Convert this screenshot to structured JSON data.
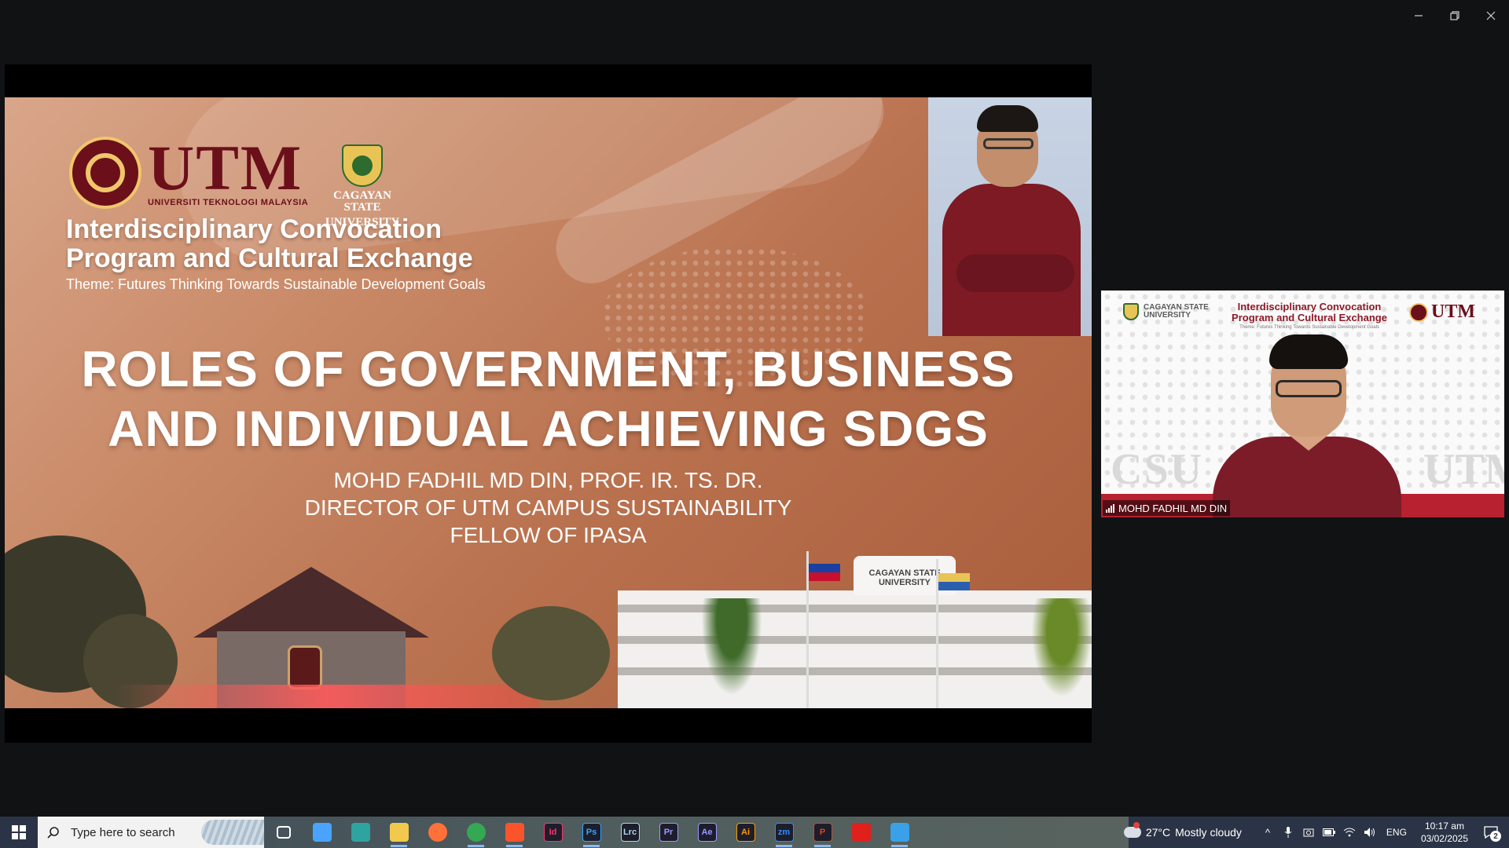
{
  "window": {
    "minimize_icon": "minimize-icon",
    "restore_icon": "restore-icon",
    "close_icon": "close-icon"
  },
  "slide": {
    "utm_logo_text": "UTM",
    "utm_logo_subtext": "UNIVERSITI TEKNOLOGI MALAYSIA",
    "csu_logo_line1": "CAGAYAN STATE",
    "csu_logo_line2": "UNIVERSITY",
    "program_line1": "Interdisciplinary Convocation",
    "program_line2": "Program and Cultural Exchange",
    "theme": "Theme: Futures Thinking Towards Sustainable Development Goals",
    "title_line1": "ROLES OF GOVERNMENT, BUSINESS",
    "title_line2": "AND INDIVIDUAL ACHIEVING SDGS",
    "speaker_line1": "MOHD FADHIL MD DIN, PROF. IR. TS. DR.",
    "speaker_line2": "DIRECTOR OF UTM CAMPUS SUSTAINABILITY",
    "speaker_line3": "FELLOW OF IPASA",
    "building_sign": "CAGAYAN STATE UNIVERSITY"
  },
  "video": {
    "csu_line1": "CAGAYAN STATE",
    "csu_line2": "UNIVERSITY",
    "title_line1": "Interdisciplinary Convocation",
    "title_line2": "Program and Cultural Exchange",
    "subtitle": "Theme: Futures Thinking Towards Sustainable Development Goals",
    "utm_text": "UTM",
    "watermark_left": "CSU",
    "watermark_right": "UTM",
    "participant_name": "MOHD FADHIL MD DIN"
  },
  "taskbar": {
    "search_placeholder": "Type here to search",
    "apps": [
      {
        "name": "task-view",
        "label": "",
        "color": "#ffffff",
        "active": false
      },
      {
        "name": "copilot",
        "label": "",
        "color": "#4aa3ff",
        "active": false
      },
      {
        "name": "predator-sense",
        "label": "",
        "color": "#2fa3a0",
        "active": false
      },
      {
        "name": "file-explorer",
        "label": "",
        "color": "#f2c94c",
        "active": true
      },
      {
        "name": "firefox",
        "label": "",
        "color": "#ff7139",
        "active": false
      },
      {
        "name": "chrome",
        "label": "",
        "color": "#34a853",
        "active": true
      },
      {
        "name": "brave",
        "label": "",
        "color": "#fb542b",
        "active": true
      },
      {
        "name": "indesign",
        "label": "Id",
        "color": "#ff3366",
        "active": false
      },
      {
        "name": "photoshop",
        "label": "Ps",
        "color": "#31a8ff",
        "active": true
      },
      {
        "name": "lightroom-classic",
        "label": "Lrc",
        "color": "#add5ec",
        "active": false
      },
      {
        "name": "premiere-pro",
        "label": "Pr",
        "color": "#9999ff",
        "active": false
      },
      {
        "name": "after-effects",
        "label": "Ae",
        "color": "#9999ff",
        "active": false
      },
      {
        "name": "illustrator",
        "label": "Ai",
        "color": "#ff9a00",
        "active": false
      },
      {
        "name": "zoom",
        "label": "zm",
        "color": "#2d8cff",
        "active": true
      },
      {
        "name": "powerpoint",
        "label": "P",
        "color": "#d24726",
        "active": true
      },
      {
        "name": "acrobat",
        "label": "",
        "color": "#e0201b",
        "active": false
      },
      {
        "name": "photos",
        "label": "",
        "color": "#3aa0e8",
        "active": true
      }
    ],
    "weather_temp": "27°C",
    "weather_desc": "Mostly cloudy",
    "language": "ENG",
    "time": "10:17 am",
    "date": "03/02/2025",
    "notification_count": "2"
  }
}
